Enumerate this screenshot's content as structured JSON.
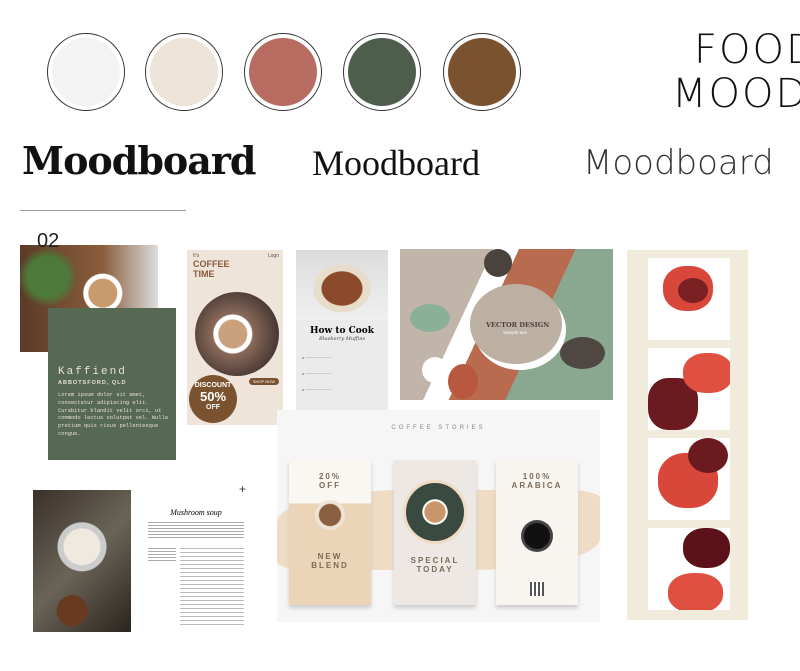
{
  "palette": [
    "#f3f3f3",
    "#ece4d8",
    "#b86b60",
    "#4d5e4d",
    "#7a5230"
  ],
  "logo": {
    "line1": "FOOD",
    "line2": "MOOD"
  },
  "headings": [
    "Moodboard",
    "Moodboard",
    "Moodboard"
  ],
  "card": {
    "number": "02",
    "title": "Kaffiend",
    "location": "ABBOTSFORD, QLD",
    "body": "Lorem ipsum dolor sit amet, consectetur adipiscing elit. Curabitur blandit velit orci, ut commodo lectus volutpat vel. Nulla pretium quis risus pellentesque congue."
  },
  "coffee_poster": {
    "small": "It's",
    "title": "COFFEE TIME",
    "logo": "Logo",
    "button": "SHOP NOW",
    "discount_label": "DISCOUNT",
    "discount": "50%",
    "off": "OFF"
  },
  "recipe": {
    "title": "How to Cook",
    "subtitle": "Blueberry Muffins"
  },
  "vector": {
    "title": "VECTOR DESIGN",
    "subtitle": "Sample text"
  },
  "stories": {
    "heading": "COFFEE STORIES",
    "cards": [
      {
        "top": "20% OFF",
        "bottom": "NEW BLEND"
      },
      {
        "top": "",
        "bottom": "SPECIAL TODAY"
      },
      {
        "top": "100% ARABICA",
        "bottom": ""
      }
    ]
  },
  "doc": {
    "title": "Mushroom soup"
  }
}
